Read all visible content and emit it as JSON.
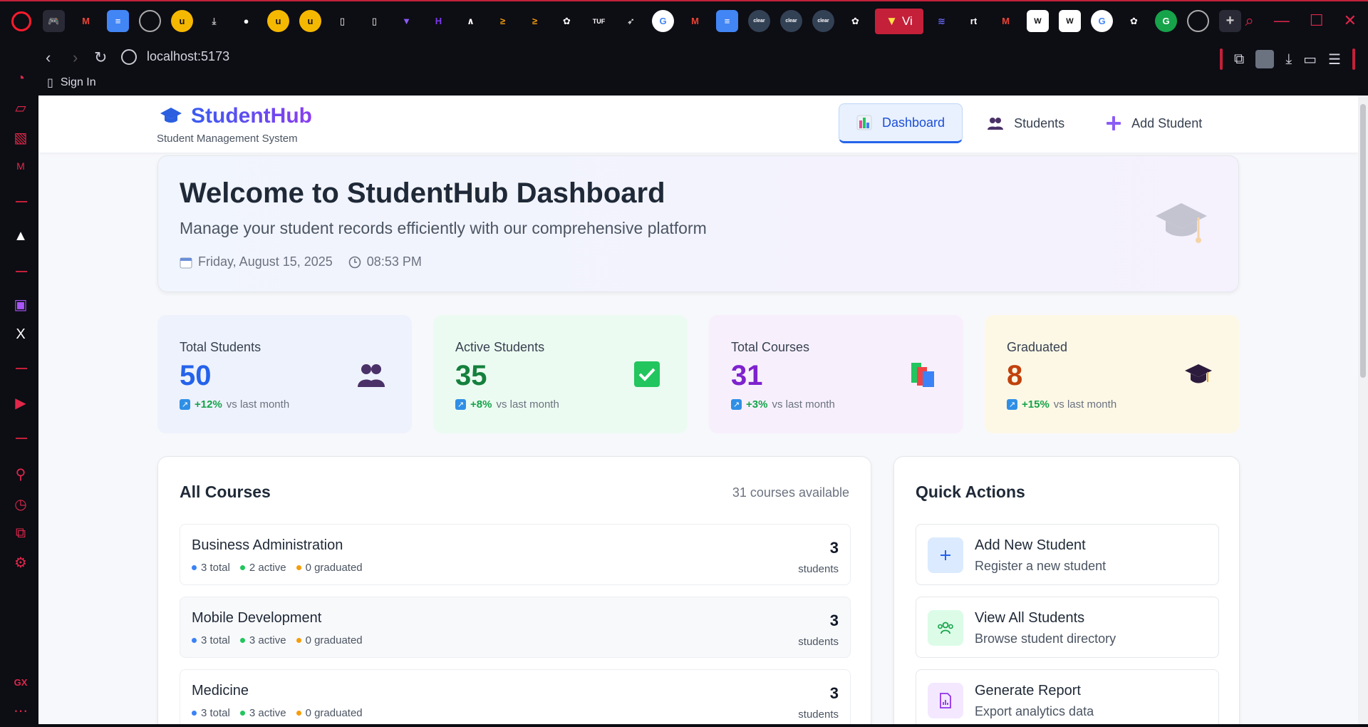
{
  "browser": {
    "url": "localhost:5173",
    "active_tab_label": "Vi",
    "bookmark_label": "Sign In"
  },
  "app": {
    "title": "StudentHub",
    "subtitle": "Student Management System",
    "nav": [
      {
        "label": "Dashboard",
        "icon": "bar-chart-icon"
      },
      {
        "label": "Students",
        "icon": "users-icon"
      },
      {
        "label": "Add Student",
        "icon": "plus-icon"
      }
    ]
  },
  "welcome": {
    "heading": "Welcome to StudentHub Dashboard",
    "tagline": "Manage your student records efficiently with our comprehensive platform",
    "date": "Friday, August 15, 2025",
    "time": "08:53 PM"
  },
  "stats": [
    {
      "label": "Total Students",
      "value": "50",
      "pct": "+12%",
      "suffix": "vs last month",
      "color": "#2563eb",
      "bg": "#eef2fc",
      "icon": "users-icon"
    },
    {
      "label": "Active Students",
      "value": "35",
      "pct": "+8%",
      "suffix": "vs last month",
      "color": "#15803d",
      "bg": "#ecfbf1",
      "icon": "check-icon"
    },
    {
      "label": "Total Courses",
      "value": "31",
      "pct": "+3%",
      "suffix": "vs last month",
      "color": "#7e22ce",
      "bg": "#f7f0fc",
      "icon": "books-icon"
    },
    {
      "label": "Graduated",
      "value": "8",
      "pct": "+15%",
      "suffix": "vs last month",
      "color": "#c2410c",
      "bg": "#fdf8e6",
      "icon": "graduation-cap-icon"
    }
  ],
  "courses": {
    "heading": "All Courses",
    "available": "31 courses available",
    "items": [
      {
        "name": "Business Administration",
        "total": "3 total",
        "active": "2 active",
        "graduated": "0 graduated",
        "count": "3",
        "unit": "students"
      },
      {
        "name": "Mobile Development",
        "total": "3 total",
        "active": "3 active",
        "graduated": "0 graduated",
        "count": "3",
        "unit": "students"
      },
      {
        "name": "Medicine",
        "total": "3 total",
        "active": "3 active",
        "graduated": "0 graduated",
        "count": "3",
        "unit": "students"
      }
    ]
  },
  "quick": {
    "heading": "Quick Actions",
    "items": [
      {
        "title": "Add New Student",
        "sub": "Register a new student",
        "icon": "plus-icon"
      },
      {
        "title": "View All Students",
        "sub": "Browse student directory",
        "icon": "users-icon"
      },
      {
        "title": "Generate Report",
        "sub": "Export analytics data",
        "icon": "report-icon"
      }
    ]
  }
}
